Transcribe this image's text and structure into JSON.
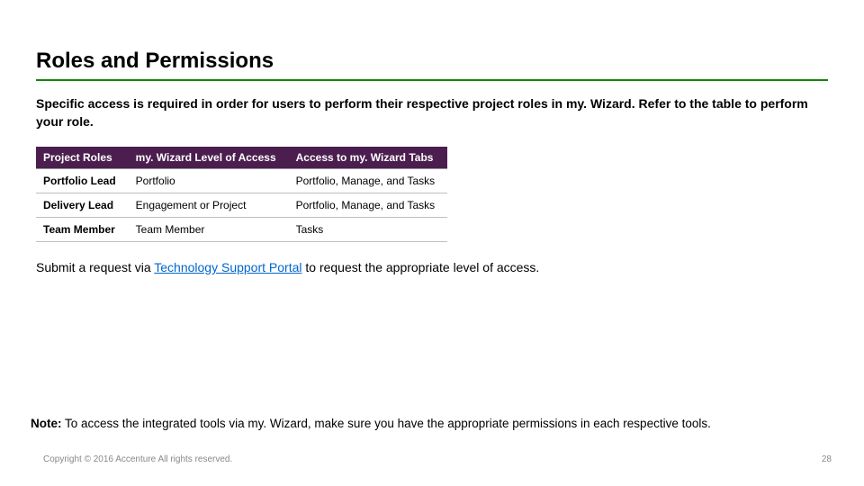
{
  "title": "Roles and Permissions",
  "intro": "Specific access is required in order for users to perform their respective project roles in my. Wizard. Refer to the table to perform your role.",
  "table": {
    "headers": [
      "Project Roles",
      "my. Wizard Level of Access",
      "Access to my. Wizard Tabs"
    ],
    "rows": [
      [
        "Portfolio Lead",
        "Portfolio",
        "Portfolio, Manage, and Tasks"
      ],
      [
        "Delivery Lead",
        "Engagement or Project",
        "Portfolio, Manage, and Tasks"
      ],
      [
        "Team Member",
        "Team Member",
        "Tasks"
      ]
    ]
  },
  "submit": {
    "prefix": "Submit a request via ",
    "link_text": "Technology Support Portal",
    "suffix": " to request the appropriate level of access."
  },
  "note": {
    "label": "Note:",
    "text": " To access the integrated tools via my. Wizard, make sure you have the appropriate permissions in each respective tools."
  },
  "copyright": "Copyright © 2016 Accenture  All rights reserved.",
  "page_number": "28"
}
